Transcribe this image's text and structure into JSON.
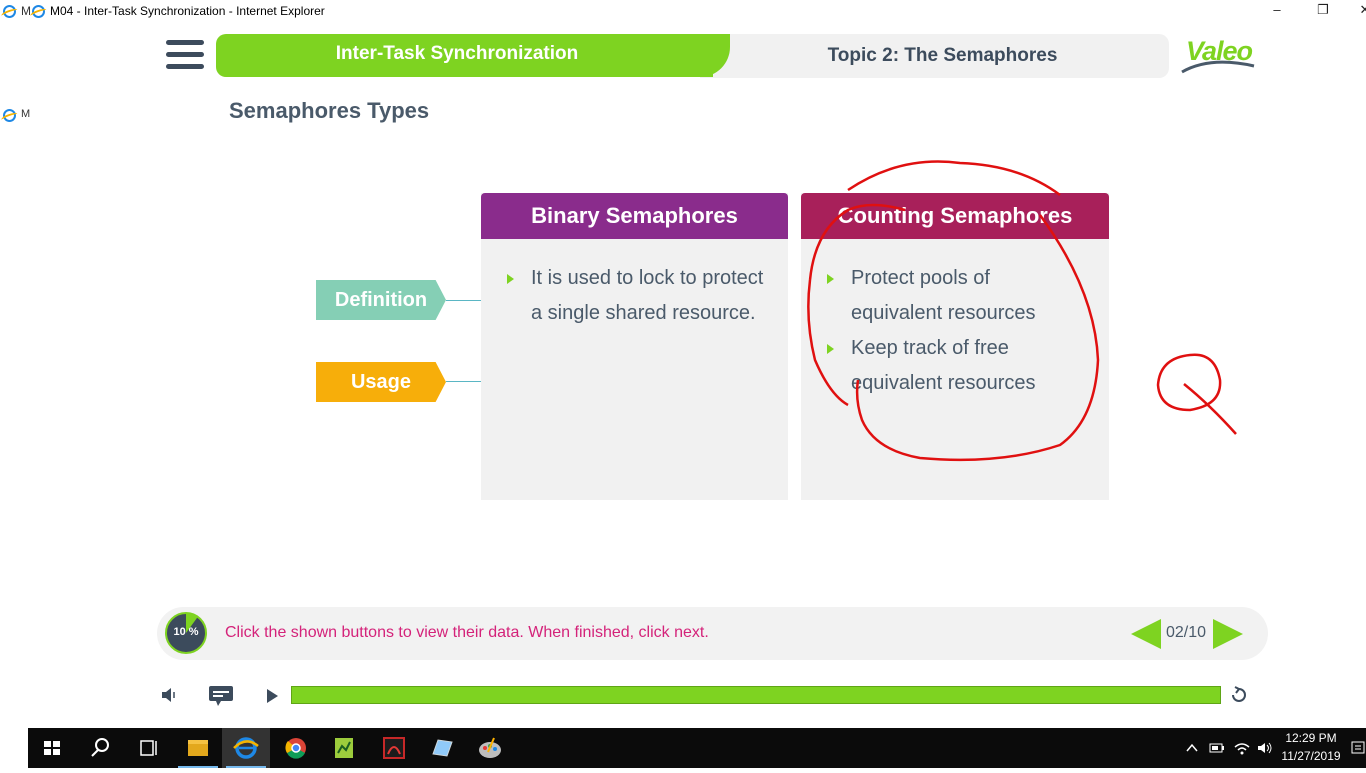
{
  "window": {
    "title": "M04 - Inter-Task Synchronization - Internet Explorer",
    "side_label": "M"
  },
  "header": {
    "course_title": "Inter-Task Synchronization",
    "topic_title": "Topic 2: The Semaphores",
    "logo_text": "Valeo"
  },
  "page": {
    "heading": "Semaphores Types"
  },
  "tabs": {
    "definition": "Definition",
    "usage": "Usage"
  },
  "cards": {
    "binary": {
      "title": "Binary Semaphores",
      "bullets": [
        "It is used to lock to protect a single shared resource."
      ]
    },
    "counting": {
      "title": "Counting Semaphores",
      "bullets": [
        "Protect pools of equivalent resources",
        "Keep track of free equivalent resources"
      ]
    }
  },
  "status": {
    "progress_label": "10 %",
    "progress_fraction": 0.1,
    "message": "Click the shown buttons to view their data. When finished, click next.",
    "page_count": "02/10"
  },
  "player": {
    "timeline_fraction": 1.0
  },
  "taskbar": {
    "time": "12:29 PM",
    "date": "11/27/2019"
  },
  "colors": {
    "accent_green": "#7ed321",
    "binary_header": "#8a2c8c",
    "counting_header": "#a8205a",
    "definition_tab": "#85cfb5",
    "usage_tab": "#f7ae0a",
    "status_text": "#d4237a",
    "annotation_red": "#e01010"
  }
}
